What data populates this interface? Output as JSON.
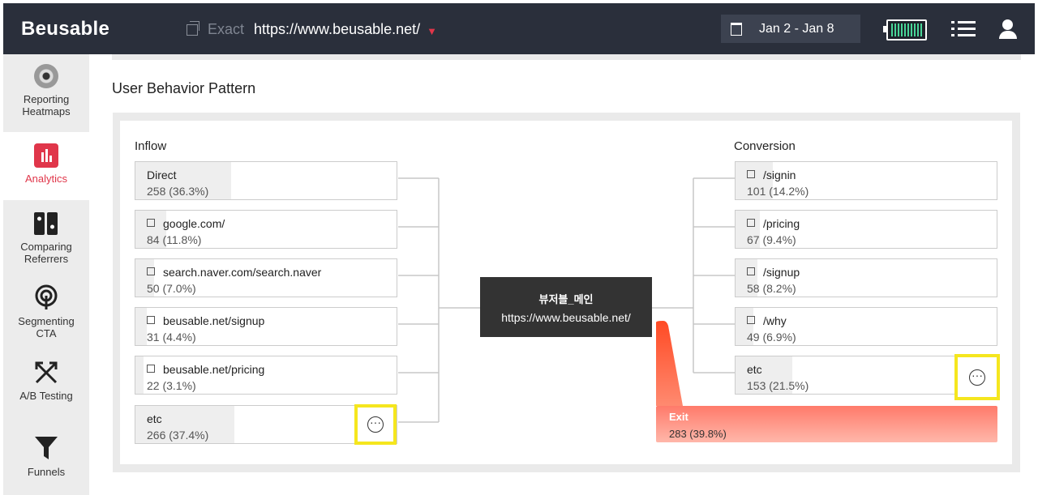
{
  "header": {
    "logo": "Beusable",
    "url_mode": "Exact",
    "url": "https://www.beusable.net/",
    "date_range": "Jan 2 - Jan 8"
  },
  "sidebar": {
    "items": [
      {
        "label": "Reporting Heatmaps",
        "icon": "target-icon",
        "active": false
      },
      {
        "label": "Analytics",
        "icon": "bar-chart-icon",
        "active": true
      },
      {
        "label": "Comparing Referrers",
        "icon": "compare-icon",
        "active": false
      },
      {
        "label": "Segmenting CTA",
        "icon": "segment-icon",
        "active": false
      },
      {
        "label": "A/B Testing",
        "icon": "ab-test-icon",
        "active": false
      },
      {
        "label": "Funnels",
        "icon": "funnel-icon",
        "active": false
      }
    ]
  },
  "main": {
    "section_title": "User Behavior Pattern",
    "inflow_title": "Inflow",
    "conversion_title": "Conversion",
    "center": {
      "title": "뷰저블_메인",
      "url": "https://www.beusable.net/"
    },
    "inflow": [
      {
        "name": "Direct",
        "stat": "258 (36.3%)",
        "share": 0.363,
        "external": false
      },
      {
        "name": "google.com/",
        "stat": "84 (11.8%)",
        "share": 0.118,
        "external": true
      },
      {
        "name": "search.naver.com/search.naver",
        "stat": "50 (7.0%)",
        "share": 0.07,
        "external": true
      },
      {
        "name": "beusable.net/signup",
        "stat": "31 (4.4%)",
        "share": 0.044,
        "external": true
      },
      {
        "name": "beusable.net/pricing",
        "stat": "22 (3.1%)",
        "share": 0.031,
        "external": true
      },
      {
        "name": "etc",
        "stat": "266 (37.4%)",
        "share": 0.374,
        "external": false
      }
    ],
    "conversion": [
      {
        "name": "/signin",
        "stat": "101 (14.2%)",
        "share": 0.142,
        "external": true
      },
      {
        "name": "/pricing",
        "stat": "67 (9.4%)",
        "share": 0.094,
        "external": true
      },
      {
        "name": "/signup",
        "stat": "58 (8.2%)",
        "share": 0.082,
        "external": true
      },
      {
        "name": "/why",
        "stat": "49 (6.9%)",
        "share": 0.069,
        "external": true
      },
      {
        "name": "etc",
        "stat": "153 (21.5%)",
        "share": 0.215,
        "external": false
      }
    ],
    "exit": {
      "label": "Exit",
      "stat": "283 (39.8%)",
      "share": 0.398
    },
    "more_button_symbol": "···"
  },
  "colors": {
    "header_bg": "#2a2f3b",
    "accent": "#e0364a",
    "highlight": "#f5e61e",
    "exit_gradient": "#ff7a6a",
    "center_node": "#333333"
  }
}
